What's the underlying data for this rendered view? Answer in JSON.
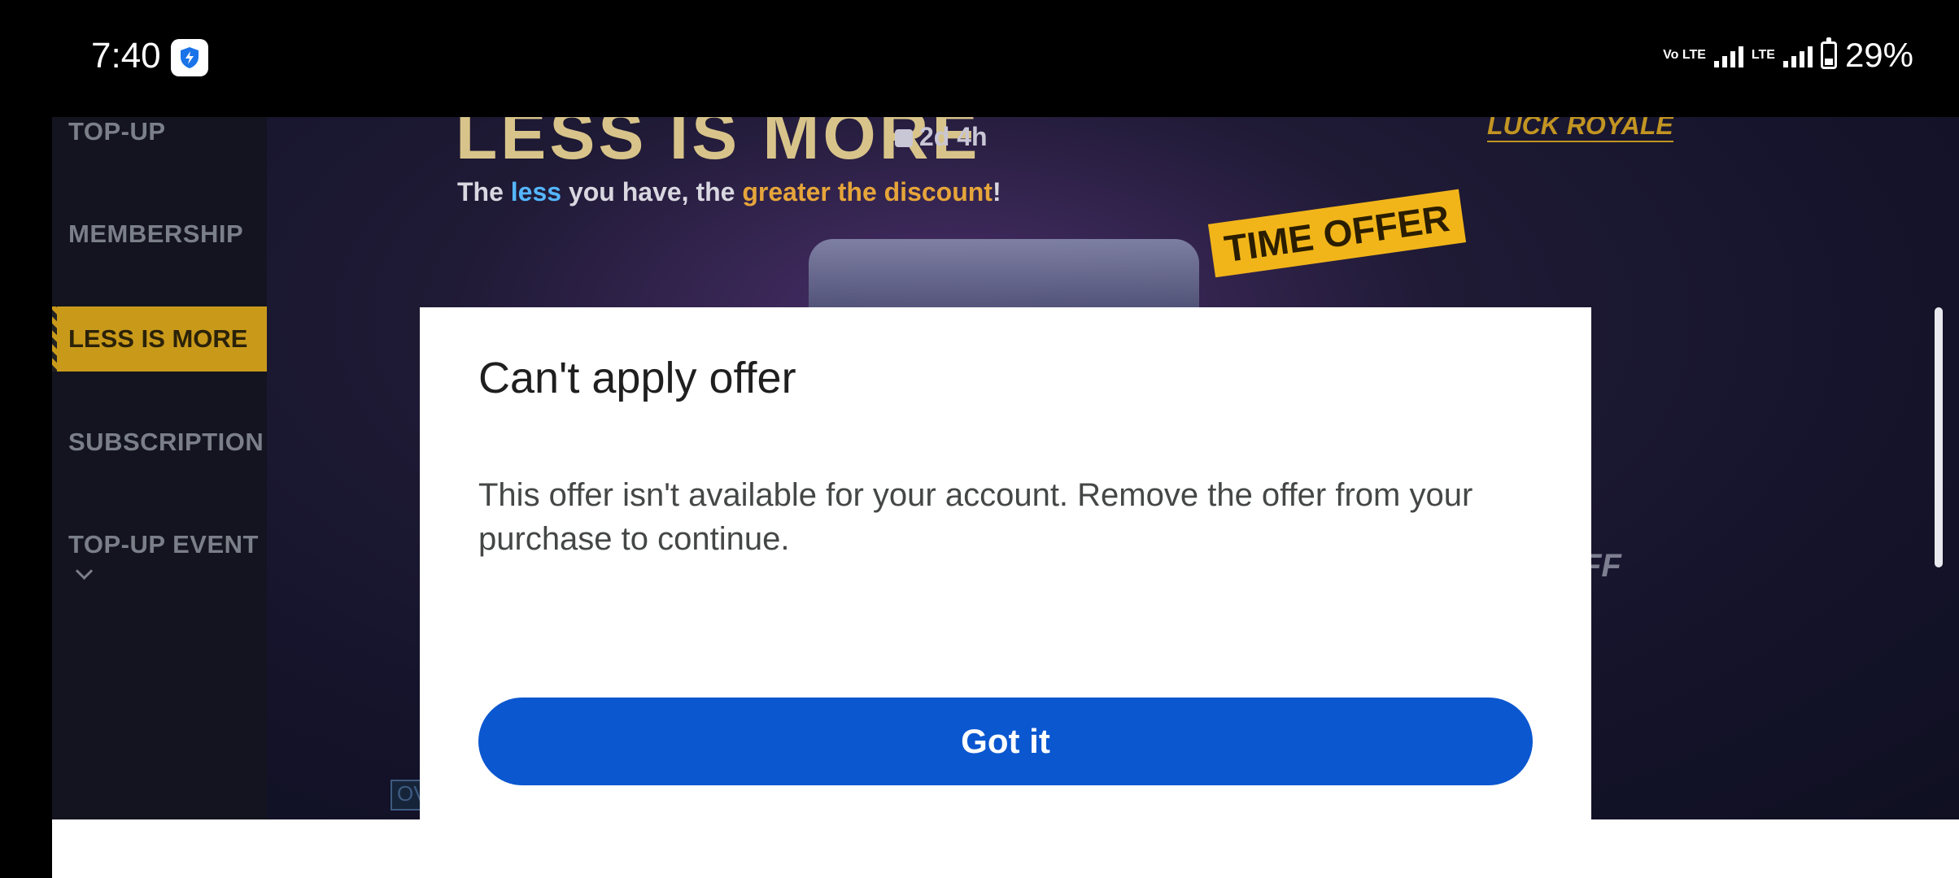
{
  "status_bar": {
    "time": "7:40",
    "app_icon": "shield-bolt-icon",
    "network_volte": "Vo LTE",
    "network_lte": "LTE",
    "battery": "29%"
  },
  "sidebar": {
    "items": [
      {
        "label": "TOP-UP"
      },
      {
        "label": "MEMBERSHIP"
      },
      {
        "label": "LESS IS MORE"
      },
      {
        "label": "SUBSCRIPTION"
      },
      {
        "label": "TOP-UP EVENT"
      }
    ],
    "active": "LESS IS MORE"
  },
  "banner": {
    "title": "LESS IS MORE",
    "timer": "2d 4h",
    "tagline_prefix": "The ",
    "tagline_less": "less",
    "tagline_mid": " you have, the ",
    "tagline_discount": "greater the discount",
    "tagline_suffix": "!",
    "luck_royale": "LUCK ROYALE",
    "time_offer": "TIME OFFER",
    "offer_text": "FF",
    "ov_tag": "OV"
  },
  "dialog": {
    "title": "Can't apply offer",
    "body": "This offer isn't available for your account. Remove the offer from your purchase to continue.",
    "button": "Got it"
  },
  "colors": {
    "dialog_button": "#0b57d0",
    "active_tab": "#c99a1a",
    "background": "#000000"
  }
}
